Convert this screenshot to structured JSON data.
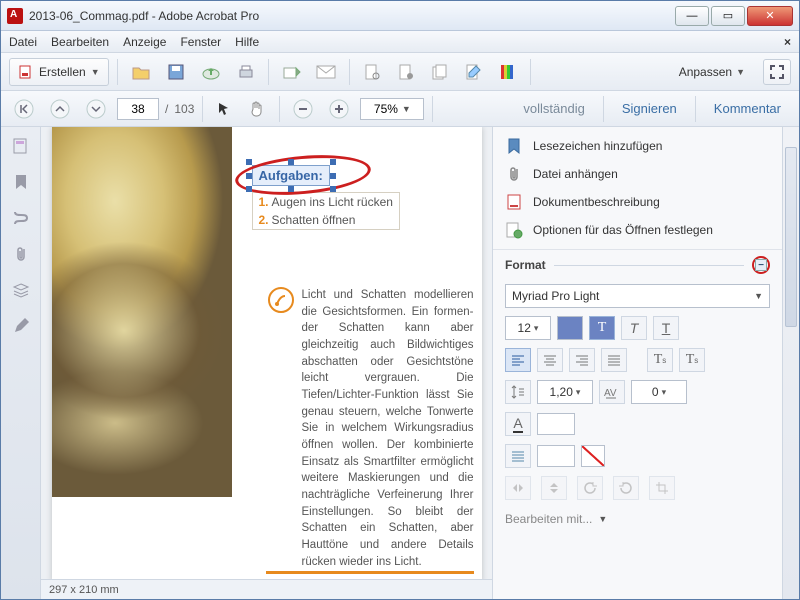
{
  "window": {
    "title": "2013-06_Commag.pdf - Adobe Acrobat Pro"
  },
  "menu": {
    "file": "Datei",
    "edit": "Bearbeiten",
    "view": "Anzeige",
    "window": "Fenster",
    "help": "Hilfe"
  },
  "toolbar": {
    "create": "Erstellen",
    "customize": "Anpassen"
  },
  "nav": {
    "page_current": "38",
    "page_total": "103",
    "page_sep": "/",
    "zoom": "75%"
  },
  "tabs": {
    "full": "vollständig",
    "sign": "Signieren",
    "comment": "Kommentar"
  },
  "rightpanel": {
    "items": [
      "Lesezeichen hinzufügen",
      "Datei anhängen",
      "Dokumentbeschreibung",
      "Optionen für das Öffnen festlegen"
    ],
    "format_label": "Format",
    "font": "Myriad Pro Light",
    "size": "12",
    "line_height": "1,20",
    "tracking": "0",
    "edit_with": "Bearbeiten mit..."
  },
  "doc": {
    "task_header": "Aufgaben:",
    "tasks": [
      {
        "n": "1.",
        "t": "Augen ins Licht rücken"
      },
      {
        "n": "2.",
        "t": "Schatten öffnen"
      }
    ],
    "body": "Licht und Schatten modellieren die Gesichtsformen. Ein formen­der Schatten kann aber gleichzeitig auch Bildwichtiges abschatten oder Ge­sichtstöne leicht vergrauen. Die Tiefen/Lichter-Funktion lässt Sie genau steuern, welche Tonwerte Sie in welchem Wir­kungsradius öffnen wollen. Der kombi­nierte Einsatz als Smartfilter ermöglicht weitere Maskierungen und die nach­trägliche Verfeinerung Ihrer Einstellun­gen. So bleibt der Schatten ein Schat­ten, aber Hauttöne und andere Details rücken wieder ins Licht."
  },
  "status": {
    "dims": "297 x 210 mm"
  }
}
